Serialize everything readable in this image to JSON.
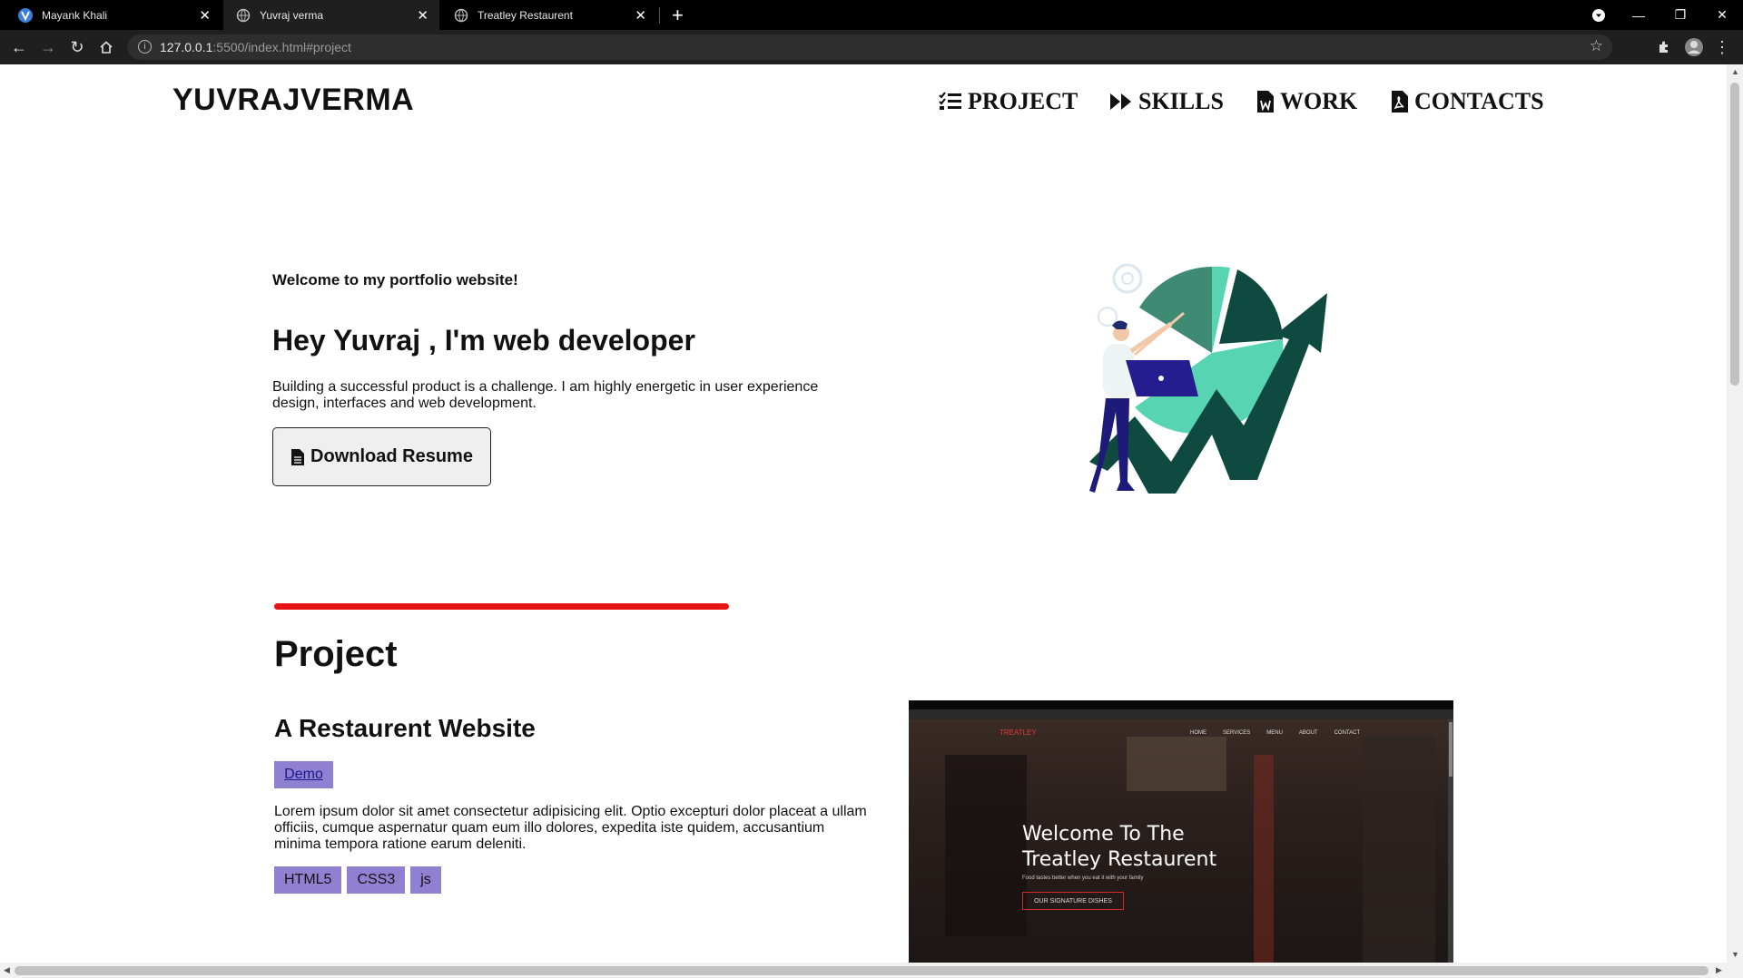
{
  "browser": {
    "tabs": [
      {
        "title": "Mayank Khali",
        "active": false,
        "icon": "app-icon"
      },
      {
        "title": "Yuvraj verma",
        "active": true,
        "icon": "globe-icon"
      },
      {
        "title": "Treatley Restaurent",
        "active": false,
        "icon": "globe-icon"
      }
    ],
    "url_host": "127.0.0.1",
    "url_path": ":5500/index.html#project"
  },
  "header": {
    "logo": "YUVRAJVERMA",
    "nav": [
      {
        "label": "PROJECT",
        "icon": "list-check-icon"
      },
      {
        "label": "SKILLS",
        "icon": "fast-forward-icon"
      },
      {
        "label": "WORK",
        "icon": "word-file-icon"
      },
      {
        "label": "CONTACTS",
        "icon": "pdf-file-icon"
      }
    ]
  },
  "hero": {
    "welcome": "Welcome to my portfolio website!",
    "title": "Hey Yuvraj , I'm web developer",
    "description": "Building a successful product is a challenge. I am highly energetic in user experience design, interfaces and web development.",
    "resume_button": "Download Resume"
  },
  "project_section": {
    "title": "Project",
    "projects": [
      {
        "name": "A Restaurent Website",
        "demo_label": "Demo",
        "description": "Lorem ipsum dolor sit amet consectetur adipisicing elit. Optio excepturi dolor placeat a ullam officiis, cumque aspernatur quam eum illo dolores, expedita iste quidem, accusantium minima tempora ratione earum deleniti.",
        "tags": [
          "HTML5",
          "CSS3",
          "js"
        ],
        "preview": {
          "brand": "TREATLEY",
          "menu": [
            "HOME",
            "SERVICES",
            "MENU",
            "ABOUT",
            "CONTACT"
          ],
          "headline_1": "Welcome To The",
          "headline_2": "Treatley Restaurent",
          "tagline": "Food tastes better when you eat it with your family",
          "cta": "OUR SIGNATURE DISHES"
        }
      }
    ]
  },
  "colors": {
    "accent_red": "#e81313",
    "tag_purple": "#8f80d1",
    "art_dark_green": "#0e4a40",
    "art_mint": "#57d5b3"
  }
}
